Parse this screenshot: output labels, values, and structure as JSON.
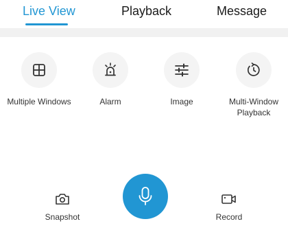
{
  "tabs": [
    {
      "label": "Live View",
      "active": true
    },
    {
      "label": "Playback",
      "active": false
    },
    {
      "label": "Message",
      "active": false
    }
  ],
  "functions": [
    {
      "label": "Multiple Windows",
      "icon": "grid-icon"
    },
    {
      "label": "Alarm",
      "icon": "alarm-siren-icon"
    },
    {
      "label": "Image",
      "icon": "sliders-icon"
    },
    {
      "label": "Multi-Window Playback",
      "icon": "playback-icon"
    }
  ],
  "controls": {
    "snapshot_label": "Snapshot",
    "record_label": "Record",
    "mic_icon": "microphone-icon"
  },
  "colors": {
    "accent": "#2196d3",
    "icon_bg": "#f4f4f4",
    "text": "#333333"
  }
}
